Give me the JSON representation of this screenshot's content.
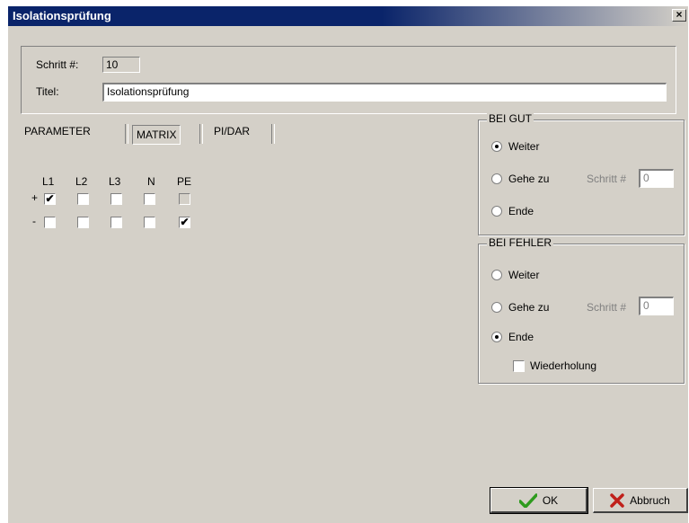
{
  "window": {
    "title": "Isolationsprüfung",
    "close_glyph": "×"
  },
  "header": {
    "step_label": "Schritt #:",
    "step_value": "10",
    "title_label": "Titel:",
    "title_value": "Isolationsprüfung"
  },
  "tabs": [
    {
      "label": "PARAMETER",
      "active": false
    },
    {
      "label": "MATRIX",
      "active": true
    },
    {
      "label": "PI/DAR",
      "active": false
    }
  ],
  "matrix": {
    "columns": [
      "L1",
      "L2",
      "L3",
      "N",
      "PE"
    ],
    "rows": [
      {
        "sign": "+",
        "checked": [
          true,
          false,
          false,
          false,
          false
        ]
      },
      {
        "sign": "-",
        "checked": [
          false,
          false,
          false,
          false,
          true
        ]
      }
    ]
  },
  "bei_gut": {
    "title": "BEI GUT",
    "options": [
      "Weiter",
      "Gehe zu",
      "Ende"
    ],
    "selected": "Weiter",
    "step_label": "Schritt #",
    "step_value": "0"
  },
  "bei_fehler": {
    "title": "BEI FEHLER",
    "options": [
      "Weiter",
      "Gehe zu",
      "Ende"
    ],
    "selected": "Ende",
    "step_label": "Schritt #",
    "step_value": "0",
    "repeat_label": "Wiederholung",
    "repeat_checked": false
  },
  "buttons": {
    "ok_label": "OK",
    "cancel_label": "Abbruch"
  },
  "colors": {
    "title_bar": "#0a246a",
    "dialog_bg": "#d4d0c8",
    "ok_check": "#2e9b1e",
    "cancel_x": "#c0201a"
  },
  "icons": {
    "ok": "check-icon",
    "cancel": "x-icon",
    "close": "close-icon"
  }
}
